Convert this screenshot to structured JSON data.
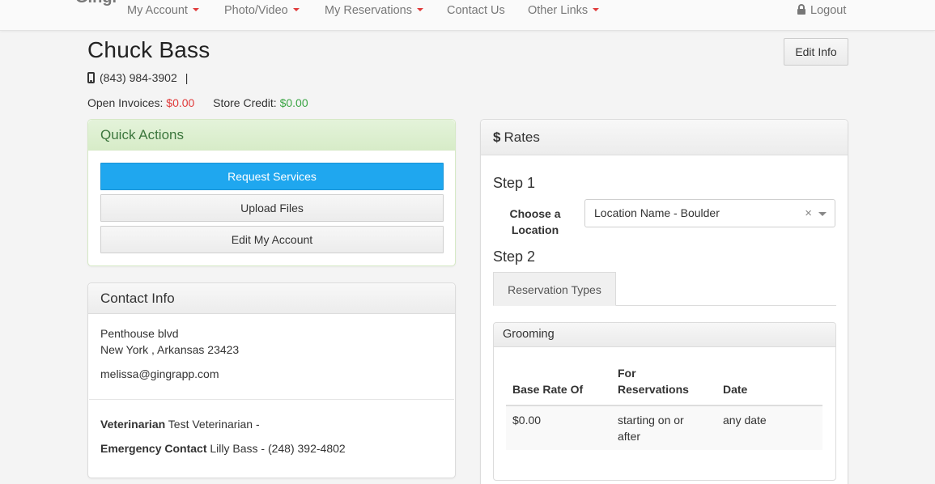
{
  "nav": {
    "brand": "Gingr",
    "items": [
      {
        "label": "My Account",
        "dropdown": true
      },
      {
        "label": "Photo/Video",
        "dropdown": true
      },
      {
        "label": "My Reservations",
        "dropdown": true
      },
      {
        "label": "Contact Us",
        "dropdown": false
      },
      {
        "label": "Other Links",
        "dropdown": true
      }
    ],
    "logout": "Logout",
    "icons": {
      "lock": "lock-icon",
      "caret": "caret-down-icon"
    }
  },
  "profile": {
    "name": "Chuck Bass",
    "phone": "(843) 984-3902",
    "separator": "|",
    "open_invoices_label": "Open Invoices:",
    "open_invoices_value": "$0.00",
    "store_credit_label": "Store Credit:",
    "store_credit_value": "$0.00",
    "edit_info": "Edit Info"
  },
  "quick_actions": {
    "title": "Quick Actions",
    "buttons": [
      "Request Services",
      "Upload Files",
      "Edit My Account"
    ]
  },
  "contact_info": {
    "title": "Contact Info",
    "address_line1": "Penthouse blvd",
    "address_line2": "New York , Arkansas 23423",
    "email": "melissa@gingrapp.com",
    "vet_label": "Veterinarian",
    "vet_value": "Test Veterinarian -",
    "emergency_label": "Emergency Contact",
    "emergency_value": "Lilly Bass - (248) 392-4802"
  },
  "rates": {
    "title": "Rates",
    "step1": "Step 1",
    "choose_label": "Choose a Location",
    "location_value": "Location Name - Boulder",
    "clear": "×",
    "step2": "Step 2",
    "tab": "Reservation Types",
    "grooming": {
      "title": "Grooming",
      "headers": [
        "Base Rate Of",
        "For Reservations",
        "Date"
      ],
      "row": [
        "$0.00",
        "starting on or after",
        "any date"
      ]
    }
  },
  "colors": {
    "primary": "#1fa7ef",
    "success_bg": "#dff0d8",
    "success_text": "#3c763d",
    "danger": "#e03a3a",
    "green": "#3aa544"
  }
}
